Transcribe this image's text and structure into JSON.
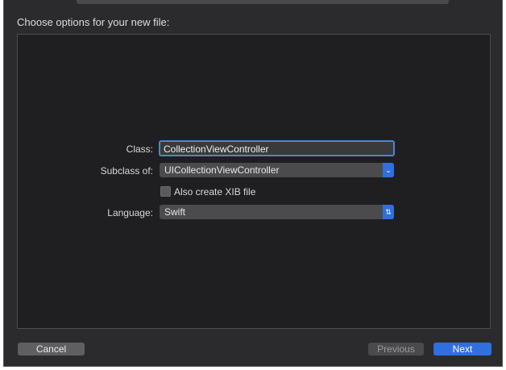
{
  "header": {
    "title": "Choose options for your new file:"
  },
  "form": {
    "class_label": "Class:",
    "class_value": "CollectionViewController",
    "subclass_label": "Subclass of:",
    "subclass_value": "UICollectionViewController",
    "xib_label": "Also create XIB file",
    "xib_checked": false,
    "language_label": "Language:",
    "language_value": "Swift"
  },
  "footer": {
    "cancel": "Cancel",
    "previous": "Previous",
    "next": "Next"
  },
  "colors": {
    "accent": "#2f6fe0",
    "background": "#2b2b2d",
    "panel": "#1f1f21"
  },
  "icons": {
    "subclass_popup": "chevron-down-icon",
    "language_popup": "up-down-arrows-icon"
  }
}
